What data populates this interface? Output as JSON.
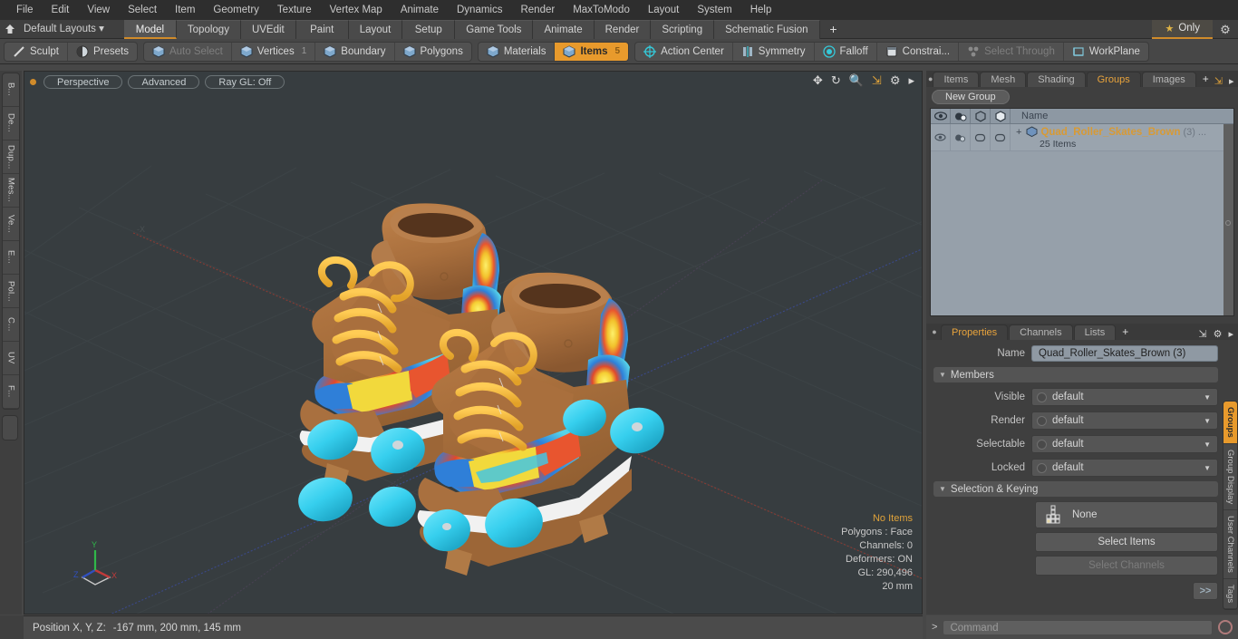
{
  "app": {
    "title": "Modo"
  },
  "menubar": {
    "items": [
      "File",
      "Edit",
      "View",
      "Select",
      "Item",
      "Geometry",
      "Texture",
      "Vertex Map",
      "Animate",
      "Dynamics",
      "Render",
      "MaxToModo",
      "Layout",
      "System",
      "Help"
    ]
  },
  "layoutbar": {
    "home_icon": "home-icon",
    "default_layouts": "Default Layouts",
    "dropdown_caret": "▾",
    "tabs": [
      {
        "label": "Model",
        "active": true
      },
      {
        "label": "Topology",
        "active": false
      },
      {
        "label": "UVEdit",
        "active": false
      },
      {
        "label": "Paint",
        "active": false
      },
      {
        "label": "Layout",
        "active": false
      },
      {
        "label": "Setup",
        "active": false
      },
      {
        "label": "Game Tools",
        "active": false
      },
      {
        "label": "Animate",
        "active": false
      },
      {
        "label": "Render",
        "active": false
      },
      {
        "label": "Scripting",
        "active": false
      },
      {
        "label": "Schematic Fusion",
        "active": false
      }
    ],
    "add_label": "+",
    "only_label": "Only",
    "only_star": "★",
    "gear_icon": "gear-icon"
  },
  "modebar": {
    "left_group": [
      {
        "label": "Sculpt",
        "icon": "sculpt-icon",
        "state": "normal"
      },
      {
        "label": "Presets",
        "icon": "presets-icon",
        "state": "normal"
      }
    ],
    "select_group": [
      {
        "label": "Auto Select",
        "icon": "cube-icon",
        "state": "dim",
        "badge": ""
      },
      {
        "label": "Vertices",
        "icon": "cube-icon",
        "state": "normal",
        "badge": "1"
      },
      {
        "label": "Boundary",
        "icon": "cube-icon",
        "state": "normal",
        "badge": ""
      },
      {
        "label": "Polygons",
        "icon": "cube-icon",
        "state": "normal",
        "badge": ""
      }
    ],
    "items_group": [
      {
        "label": "Materials",
        "icon": "cube-icon",
        "state": "normal",
        "badge": ""
      },
      {
        "label": "Items",
        "icon": "cube-icon",
        "state": "active",
        "badge": "5"
      }
    ],
    "tool_group": [
      {
        "label": "Action Center",
        "icon": "target-icon",
        "state": "normal"
      },
      {
        "label": "Symmetry",
        "icon": "symmetry-icon",
        "state": "normal"
      },
      {
        "label": "Falloff",
        "icon": "falloff-icon",
        "state": "normal"
      },
      {
        "label": "Constrai...",
        "icon": "constraint-icon",
        "state": "normal"
      },
      {
        "label": "Select Through",
        "icon": "select-through-icon",
        "state": "dim"
      },
      {
        "label": "WorkPlane",
        "icon": "workplane-icon",
        "state": "normal"
      }
    ]
  },
  "left_rail": {
    "tabs": [
      "B...",
      "De...",
      "Dup...",
      "Mes...",
      "Ve...",
      "E...",
      "Pol...",
      "C...",
      "UV",
      "F..."
    ]
  },
  "viewport": {
    "dot_color": "#d08b2a",
    "pills": [
      "Perspective",
      "Advanced",
      "Ray GL: Off"
    ],
    "icons": [
      "move-icon",
      "rotate-icon",
      "zoom-icon",
      "fit-icon",
      "gear-icon",
      "chevron-right-icon"
    ],
    "background_color": "#373d40",
    "stats": {
      "selection": "No Items",
      "polygons": "Polygons : Face",
      "channels": "Channels: 0",
      "deformers": "Deformers: ON",
      "gl": "GL: 290,496",
      "grid": "20 mm"
    },
    "axis_labels": {
      "x": "X",
      "y": "Y",
      "z": "Z"
    },
    "model": {
      "name": "Quad Roller Skates Brown",
      "colors": {
        "leather": "#a9703f",
        "leather_dark": "#8d5a30",
        "laces": "#f0b33c",
        "wheels": "#3bd2ef",
        "sole": "#f2f2f2",
        "tiedye_yellow": "#f2d93c",
        "tiedye_blue": "#2f7fd8",
        "tiedye_red": "#e0482f",
        "tiedye_cyan": "#45c6e0"
      }
    }
  },
  "groups_panel": {
    "tabs": [
      {
        "label": "Items",
        "active": false
      },
      {
        "label": "Mesh ...",
        "active": false
      },
      {
        "label": "Shading",
        "active": false
      },
      {
        "label": "Groups",
        "active": true
      },
      {
        "label": "Images",
        "active": false
      }
    ],
    "add_label": "+",
    "new_group_label": "New Group",
    "columns": [
      "eye-icon",
      "render-icon",
      "select-icon",
      "lock-icon"
    ],
    "name_header": "Name",
    "rows": [
      {
        "expand": "+",
        "icon": "group-item-icon",
        "name": "Quad_Roller_Skates_Brown",
        "count": "(3)",
        "ellipsis": "...",
        "sub": "25 Items"
      }
    ]
  },
  "properties_panel": {
    "tabs": [
      {
        "label": "Properties",
        "active": true
      },
      {
        "label": "Channels",
        "active": false
      },
      {
        "label": "Lists",
        "active": false
      }
    ],
    "add_label": "+",
    "name_label": "Name",
    "name_value": "Quad_Roller_Skates_Brown (3)",
    "members_section": "Members",
    "members": [
      {
        "label": "Visible",
        "value": "default"
      },
      {
        "label": "Render",
        "value": "default"
      },
      {
        "label": "Selectable",
        "value": "default"
      },
      {
        "label": "Locked",
        "value": "default"
      }
    ],
    "selection_section": "Selection & Keying",
    "none_value": "None",
    "select_items_label": "Select Items",
    "select_channels_label": "Select Channels",
    "forward_label": ">>"
  },
  "right_rail": {
    "tabs": [
      {
        "label": "Groups",
        "active": true
      },
      {
        "label": "Group Display",
        "active": false
      },
      {
        "label": "User Channels",
        "active": false
      },
      {
        "label": "Tags",
        "active": false
      }
    ]
  },
  "statusbar": {
    "position_label": "Position X, Y, Z:",
    "position_value": "-167 mm, 200 mm, 145 mm"
  },
  "command_bar": {
    "prompt": ">",
    "placeholder": "Command",
    "record_icon": "record-icon"
  }
}
